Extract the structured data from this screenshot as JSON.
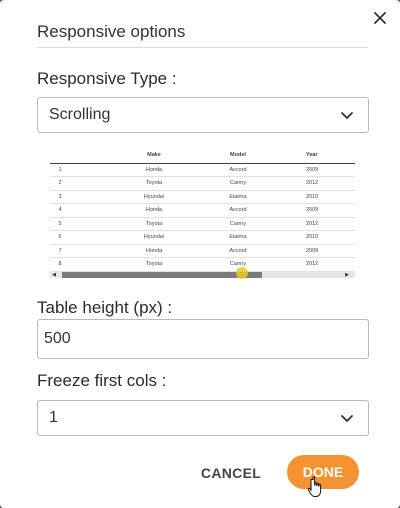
{
  "dialog": {
    "title": "Responsive options",
    "close_icon": "close-icon"
  },
  "responsive_type": {
    "label": "Responsive Type :",
    "selected": "Scrolling"
  },
  "preview_table": {
    "headers": [
      "",
      "Make",
      "Model",
      "Year"
    ],
    "rows": [
      [
        "1",
        "Honda",
        "Accord",
        "2009"
      ],
      [
        "2",
        "Toyota",
        "Camry",
        "2012"
      ],
      [
        "3",
        "Hyundai",
        "Elantra",
        "2010"
      ],
      [
        "4",
        "Honda",
        "Accord",
        "2009"
      ],
      [
        "5",
        "Toyota",
        "Camry",
        "2012"
      ],
      [
        "6",
        "Hyundai",
        "Elantra",
        "2010"
      ],
      [
        "7",
        "Honda",
        "Accord",
        "2009"
      ],
      [
        "8",
        "Toyota",
        "Camry",
        "2012"
      ]
    ]
  },
  "table_height": {
    "label": "Table height (px) :",
    "value": "500"
  },
  "freeze_cols": {
    "label": "Freeze first cols :",
    "selected": "1"
  },
  "actions": {
    "cancel_label": "CANCEL",
    "done_label": "DONE"
  },
  "colors": {
    "accent": "#f59232",
    "border": "#b9b9b9"
  }
}
